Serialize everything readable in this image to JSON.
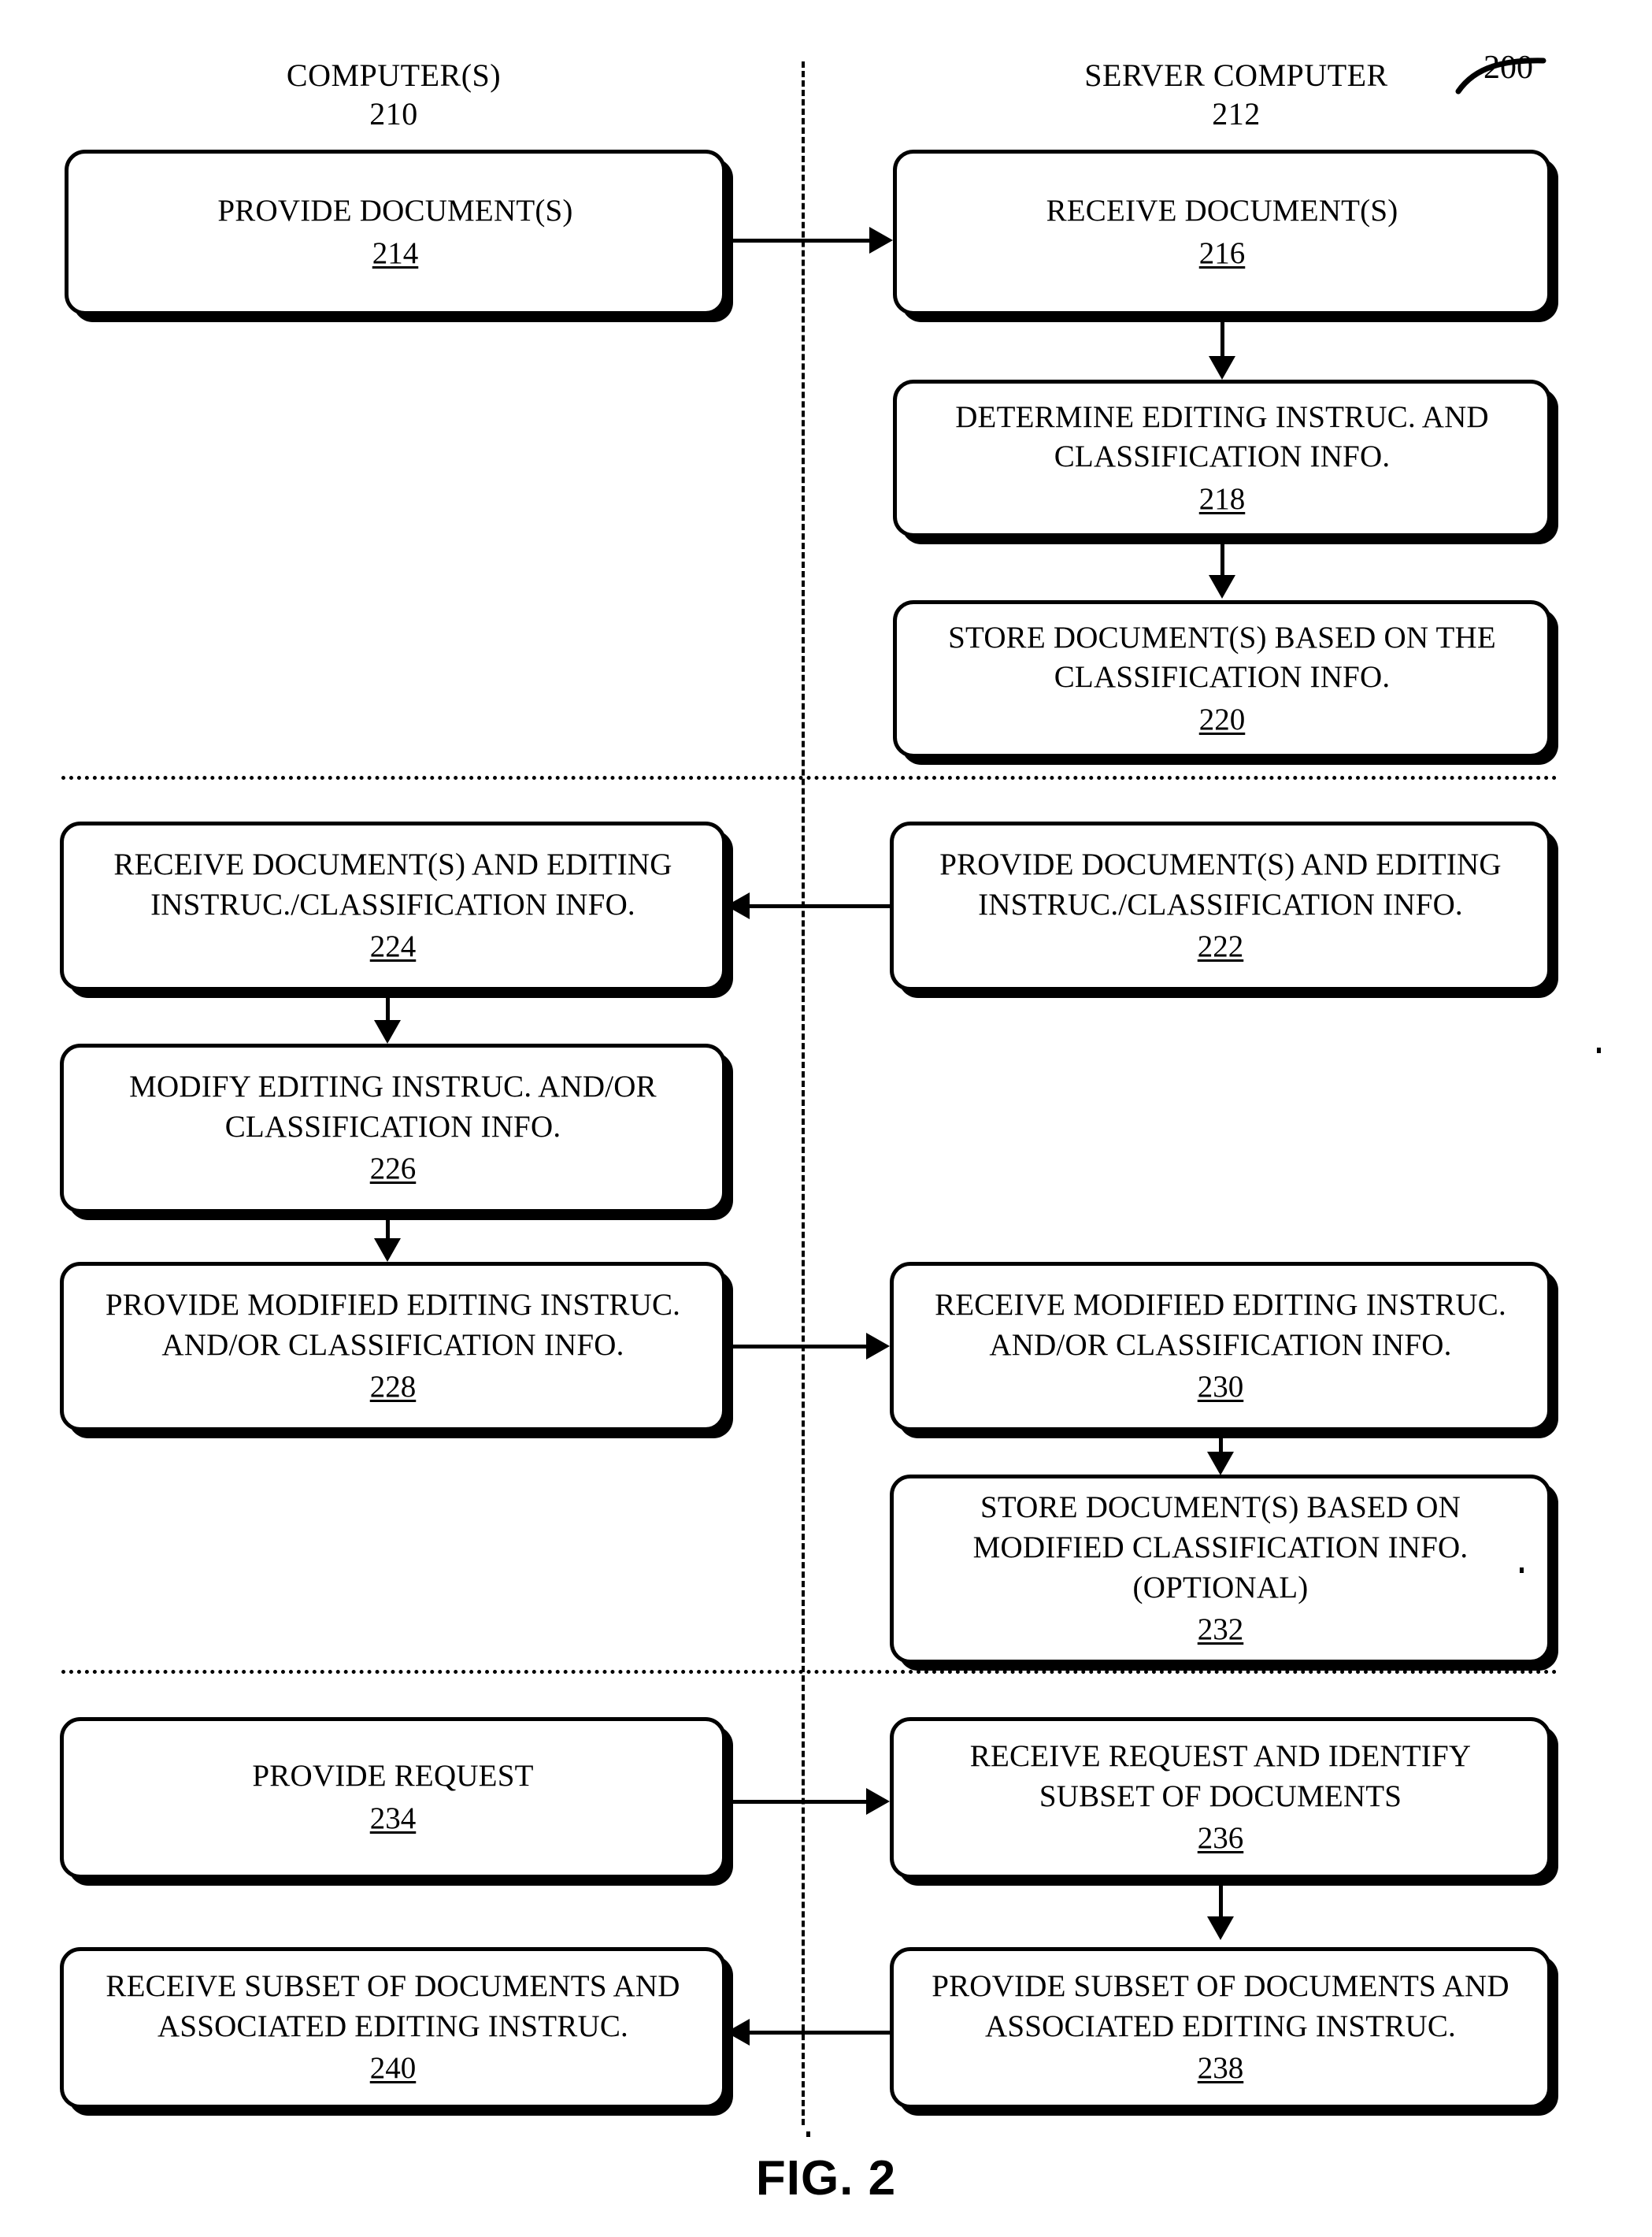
{
  "figure": {
    "caption": "FIG. 2",
    "reference_numeral": "200"
  },
  "columns": [
    {
      "title": "COMPUTER(S)",
      "number": "210"
    },
    {
      "title": "SERVER COMPUTER",
      "number": "212"
    }
  ],
  "nodes": [
    {
      "id": "214",
      "column": "left",
      "lines": [
        "PROVIDE DOCUMENT(S)"
      ],
      "ref": "214"
    },
    {
      "id": "216",
      "column": "right",
      "lines": [
        "RECEIVE DOCUMENT(S)"
      ],
      "ref": "216"
    },
    {
      "id": "218",
      "column": "right",
      "lines": [
        "DETERMINE EDITING INSTRUC. AND",
        "CLASSIFICATION INFO."
      ],
      "ref": "218"
    },
    {
      "id": "220",
      "column": "right",
      "lines": [
        "STORE DOCUMENT(S) BASED ON THE",
        "CLASSIFICATION INFO."
      ],
      "ref": "220"
    },
    {
      "id": "224",
      "column": "left",
      "lines": [
        "RECEIVE DOCUMENT(S) AND EDITING",
        "INSTRUC./CLASSIFICATION INFO."
      ],
      "ref": "224"
    },
    {
      "id": "222",
      "column": "right",
      "lines": [
        "PROVIDE DOCUMENT(S) AND EDITING",
        "INSTRUC./CLASSIFICATION INFO."
      ],
      "ref": "222"
    },
    {
      "id": "226",
      "column": "left",
      "lines": [
        "MODIFY EDITING INSTRUC. AND/OR",
        "CLASSIFICATION INFO."
      ],
      "ref": "226"
    },
    {
      "id": "228",
      "column": "left",
      "lines": [
        "PROVIDE MODIFIED EDITING INSTRUC.",
        "AND/OR CLASSIFICATION INFO."
      ],
      "ref": "228"
    },
    {
      "id": "230",
      "column": "right",
      "lines": [
        "RECEIVE MODIFIED EDITING INSTRUC.",
        "AND/OR CLASSIFICATION INFO."
      ],
      "ref": "230"
    },
    {
      "id": "232",
      "column": "right",
      "lines": [
        "STORE DOCUMENT(S) BASED ON",
        "MODIFIED CLASSIFICATION INFO.",
        "(OPTIONAL)"
      ],
      "ref": "232"
    },
    {
      "id": "234",
      "column": "left",
      "lines": [
        "PROVIDE REQUEST"
      ],
      "ref": "234"
    },
    {
      "id": "236",
      "column": "right",
      "lines": [
        "RECEIVE REQUEST AND IDENTIFY",
        "SUBSET OF DOCUMENTS"
      ],
      "ref": "236"
    },
    {
      "id": "240",
      "column": "left",
      "lines": [
        "RECEIVE SUBSET OF DOCUMENTS AND",
        "ASSOCIATED EDITING INSTRUC."
      ],
      "ref": "240"
    },
    {
      "id": "238",
      "column": "right",
      "lines": [
        "PROVIDE SUBSET OF DOCUMENTS AND",
        "ASSOCIATED EDITING INSTRUC."
      ],
      "ref": "238"
    }
  ],
  "connections": [
    {
      "from": "214",
      "to": "216",
      "direction": "right"
    },
    {
      "from": "216",
      "to": "218",
      "direction": "down"
    },
    {
      "from": "218",
      "to": "220",
      "direction": "down"
    },
    {
      "from": "222",
      "to": "224",
      "direction": "left"
    },
    {
      "from": "224",
      "to": "226",
      "direction": "down"
    },
    {
      "from": "226",
      "to": "228",
      "direction": "down"
    },
    {
      "from": "228",
      "to": "230",
      "direction": "right"
    },
    {
      "from": "230",
      "to": "232",
      "direction": "down"
    },
    {
      "from": "234",
      "to": "236",
      "direction": "right"
    },
    {
      "from": "236",
      "to": "238",
      "direction": "down"
    },
    {
      "from": "238",
      "to": "240",
      "direction": "left"
    }
  ],
  "colors": {
    "ink": "#000000",
    "paper": "#ffffff"
  }
}
